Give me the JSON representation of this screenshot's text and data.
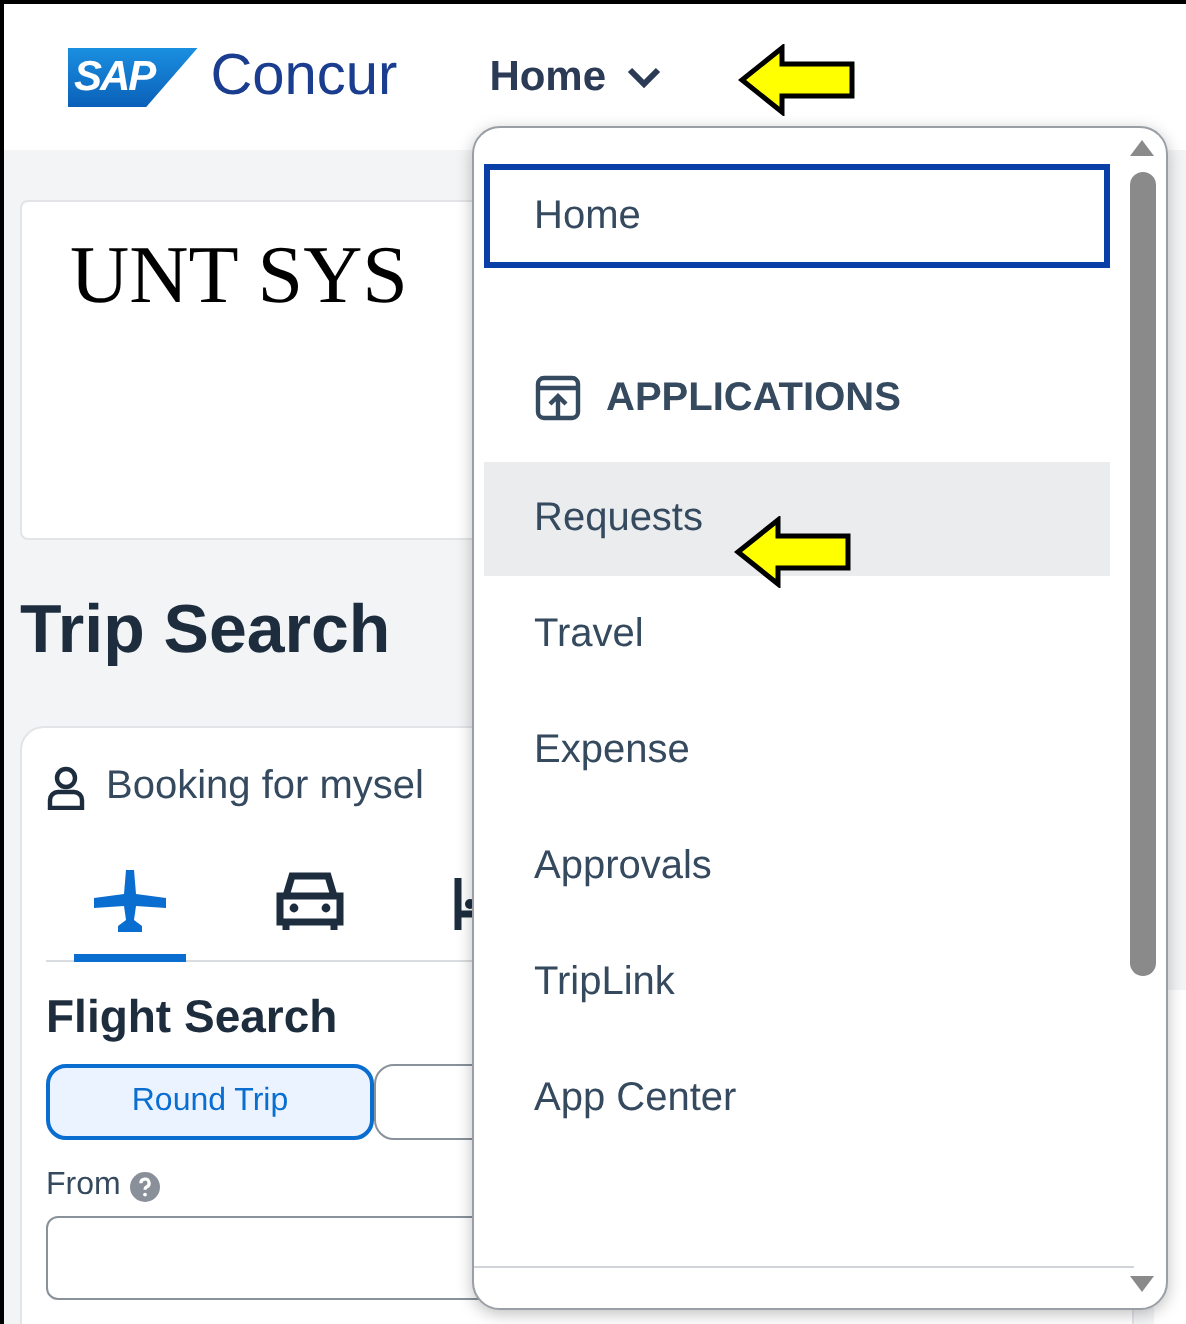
{
  "header": {
    "logo": {
      "mark": "SAP",
      "name": "Concur"
    },
    "nav": {
      "label": "Home",
      "expanded": true
    }
  },
  "org_banner": {
    "title": "UNT SYS"
  },
  "trip_search": {
    "title": "Trip Search",
    "booking_for": "Booking for mysel",
    "tabs": [
      {
        "kind": "flight",
        "selected": true
      },
      {
        "kind": "car",
        "selected": false
      },
      {
        "kind": "hotel",
        "selected": false
      }
    ],
    "section_title": "Flight Search",
    "trip_types": [
      {
        "label": "Round Trip",
        "selected": true
      },
      {
        "selected": false
      }
    ],
    "from_label": "From"
  },
  "menu": {
    "items": [
      {
        "kind": "link",
        "label": "Home",
        "selected": true,
        "hovered": false
      },
      {
        "kind": "header",
        "label": "APPLICATIONS"
      },
      {
        "kind": "link",
        "label": "Requests",
        "selected": false,
        "hovered": true
      },
      {
        "kind": "link",
        "label": "Travel",
        "selected": false,
        "hovered": false
      },
      {
        "kind": "link",
        "label": "Expense",
        "selected": false,
        "hovered": false
      },
      {
        "kind": "link",
        "label": "Approvals",
        "selected": false,
        "hovered": false
      },
      {
        "kind": "link",
        "label": "TripLink",
        "selected": false,
        "hovered": false
      },
      {
        "kind": "link",
        "label": "App Center",
        "selected": false,
        "hovered": false
      }
    ]
  }
}
